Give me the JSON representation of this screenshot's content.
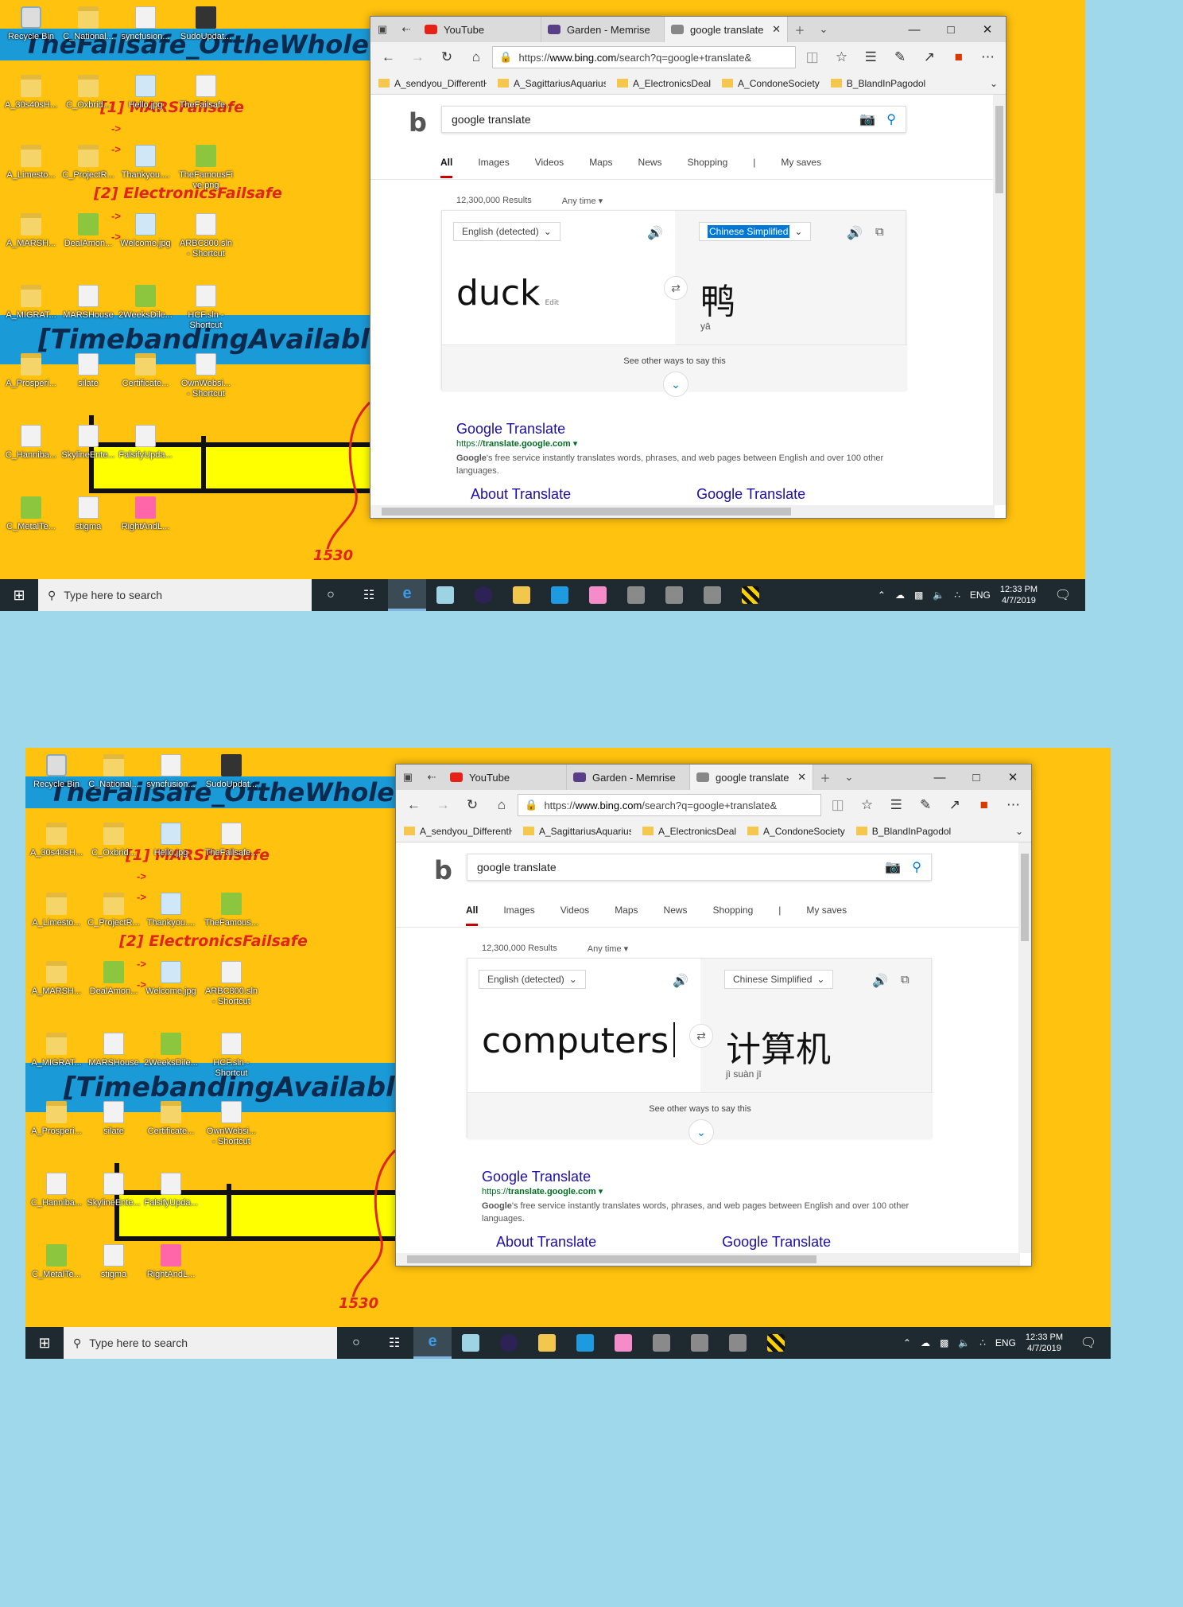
{
  "shots": [
    {
      "desktop": {
        "icons": [
          {
            "label": "Recycle Bin",
            "kind": "recycle"
          },
          {
            "label": "C_National...",
            "kind": "folder"
          },
          {
            "label": "syncfusion...",
            "kind": "file"
          },
          {
            "label": "SudoUpdat...",
            "kind": "dark"
          },
          {
            "label": "A_30s40sH...",
            "kind": "folder"
          },
          {
            "label": "C_Oxbrid...",
            "kind": "folder"
          },
          {
            "label": "Hello.jpg",
            "kind": "img"
          },
          {
            "label": "TheFailsafe...",
            "kind": "file"
          },
          {
            "label": "A_Limesto...",
            "kind": "folder"
          },
          {
            "label": "C_ProjectR...",
            "kind": "folder"
          },
          {
            "label": "Thankyou....",
            "kind": "img"
          },
          {
            "label": "TheFamousFi\nve.png",
            "kind": "green"
          },
          {
            "label": "A_MARSH...",
            "kind": "folder"
          },
          {
            "label": "DealAmon...",
            "kind": "green"
          },
          {
            "label": "Welcome.jpg",
            "kind": "img"
          },
          {
            "label": "ARBC800.sln\n- Shortcut",
            "kind": "file"
          },
          {
            "label": "A_MIGRAT...",
            "kind": "folder"
          },
          {
            "label": "MARSHouse",
            "kind": "file"
          },
          {
            "label": "2WeeksDile...",
            "kind": "green"
          },
          {
            "label": "HCF.sln -\nShortcut",
            "kind": "file"
          },
          {
            "label": "A_Prosperi...",
            "kind": "folder"
          },
          {
            "label": "silate",
            "kind": "file"
          },
          {
            "label": "Certificate...",
            "kind": "folder"
          },
          {
            "label": "OwnWebsi...\n- Shortcut",
            "kind": "file"
          },
          {
            "label": "C_Hanniba...",
            "kind": "file"
          },
          {
            "label": "SkylineEnte...",
            "kind": "file"
          },
          {
            "label": "FalsifyUpda...",
            "kind": "file"
          },
          {
            "label": "",
            "kind": "none"
          },
          {
            "label": "C_MetalTe...",
            "kind": "green"
          },
          {
            "label": "stigma",
            "kind": "file"
          },
          {
            "label": "RightAndL...",
            "kind": "pink"
          }
        ],
        "banner_top": "TheFailsafe_OftheWholeOp",
        "banner_mid": "[TimebandingAvailable]_f",
        "red_note_1": "[1] MARSFailsafe",
        "red_note_2": "[2] ElectronicsFailsafe",
        "arrow_1": "->",
        "arrow_2": "->",
        "arrow_3": "->",
        "arrow_4": "->",
        "year_label": "1530"
      },
      "browser": {
        "tabs": [
          {
            "label": "YouTube",
            "color": "#e62117",
            "active": false
          },
          {
            "label": "Garden - Memrise",
            "color": "#5a3e8a",
            "active": false
          },
          {
            "label": "google translate",
            "color": "#888888",
            "active": true
          }
        ],
        "url_prefix": "https://",
        "url_host": "www.bing.com",
        "url_rest": "/search?q=google+translate&",
        "bookmarks": [
          "A_sendyou_DifferentH",
          "A_SagittariusAquarius",
          "A_ElectronicsDeal",
          "A_CondoneSociety",
          "B_BlandInPagodol"
        ],
        "search_query": "google translate",
        "scopes": [
          "All",
          "Images",
          "Videos",
          "Maps",
          "News",
          "Shopping",
          "|",
          "My saves"
        ],
        "results_count": "12,300,000 Results",
        "time_filter": "Any time",
        "source_lang": "English (detected)",
        "target_lang": "Chinese Simplified",
        "target_highlighted": true,
        "source_text": "duck",
        "edit_label": "Edit",
        "target_text": "鸭",
        "target_pinyin": "yā",
        "other_ways": "See other ways to say this",
        "result_title": "Google Translate",
        "result_url_plain": "https://",
        "result_url_bold": "translate.google.com",
        "result_desc_bold": "Google",
        "result_desc": "'s free service instantly translates words, phrases, and web pages between English and over 100 other languages.",
        "sublink_1": "About Translate",
        "sublink_2": "Google Translate"
      },
      "taskbar": {
        "search_placeholder": "Type here to search",
        "lang": "ENG",
        "time": "12:33 PM",
        "date": "4/7/2019"
      }
    },
    {
      "desktop": {
        "icons": [
          {
            "label": "Recycle Bin",
            "kind": "recycle"
          },
          {
            "label": "C_National...",
            "kind": "folder"
          },
          {
            "label": "syncfusion...",
            "kind": "file"
          },
          {
            "label": "SudoUpdat...",
            "kind": "dark"
          },
          {
            "label": "A_30s40sH...",
            "kind": "folder"
          },
          {
            "label": "C_Oxbrid...",
            "kind": "folder"
          },
          {
            "label": "Hello.jpg",
            "kind": "img"
          },
          {
            "label": "TheFailsafe...",
            "kind": "file"
          },
          {
            "label": "A_Limesto...",
            "kind": "folder"
          },
          {
            "label": "C_ProjectR...",
            "kind": "folder"
          },
          {
            "label": "Thankyou....",
            "kind": "img"
          },
          {
            "label": "TheFamous...",
            "kind": "green"
          },
          {
            "label": "A_MARSH...",
            "kind": "folder"
          },
          {
            "label": "DealAmon...",
            "kind": "green"
          },
          {
            "label": "Welcome.jpg",
            "kind": "img"
          },
          {
            "label": "ARBC800.sln\n- Shortcut",
            "kind": "file"
          },
          {
            "label": "A_MIGRAT...",
            "kind": "folder"
          },
          {
            "label": "MARSHouse",
            "kind": "file"
          },
          {
            "label": "2WeeksDile...",
            "kind": "green"
          },
          {
            "label": "HCF.sln -\nShortcut",
            "kind": "file"
          },
          {
            "label": "A_Prosperi...",
            "kind": "folder"
          },
          {
            "label": "silate",
            "kind": "file"
          },
          {
            "label": "Certificate...",
            "kind": "folder"
          },
          {
            "label": "OwnWebsi...\n- Shortcut",
            "kind": "file"
          },
          {
            "label": "C_Hanniba...",
            "kind": "file"
          },
          {
            "label": "SkylineEnte...",
            "kind": "file"
          },
          {
            "label": "FalsifyUpda...",
            "kind": "file"
          },
          {
            "label": "",
            "kind": "none"
          },
          {
            "label": "C_MetalTe...",
            "kind": "green"
          },
          {
            "label": "stigma",
            "kind": "file"
          },
          {
            "label": "RightAndL...",
            "kind": "pink"
          }
        ],
        "banner_top": "TheFailsafe_OftheWholeOp",
        "banner_mid": "[TimebandingAvailable]_f",
        "red_note_1": "[1] MARSFailsafe",
        "red_note_2": "[2] ElectronicsFailsafe",
        "arrow_1": "->",
        "arrow_2": "->",
        "arrow_3": "->",
        "arrow_4": "->",
        "year_label": "1530"
      },
      "browser": {
        "tabs": [
          {
            "label": "YouTube",
            "color": "#e62117",
            "active": false
          },
          {
            "label": "Garden - Memrise",
            "color": "#5a3e8a",
            "active": false
          },
          {
            "label": "google translate",
            "color": "#888888",
            "active": true
          }
        ],
        "url_prefix": "https://",
        "url_host": "www.bing.com",
        "url_rest": "/search?q=google+translate&",
        "bookmarks": [
          "A_sendyou_DifferentH",
          "A_SagittariusAquarius",
          "A_ElectronicsDeal",
          "A_CondoneSociety",
          "B_BlandInPagodol"
        ],
        "search_query": "google translate",
        "scopes": [
          "All",
          "Images",
          "Videos",
          "Maps",
          "News",
          "Shopping",
          "|",
          "My saves"
        ],
        "results_count": "12,300,000 Results",
        "time_filter": "Any time",
        "source_lang": "English (detected)",
        "target_lang": "Chinese Simplified",
        "target_highlighted": false,
        "source_text": "computers",
        "edit_label": "",
        "target_text": "计算机",
        "target_pinyin": "jì suàn jī",
        "other_ways": "See other ways to say this",
        "result_title": "Google Translate",
        "result_url_plain": "https://",
        "result_url_bold": "translate.google.com",
        "result_desc_bold": "Google",
        "result_desc": "'s free service instantly translates words, phrases, and web pages between English and over 100 other languages.",
        "sublink_1": "About Translate",
        "sublink_2": "Google Translate"
      },
      "taskbar": {
        "search_placeholder": "Type here to search",
        "lang": "ENG",
        "time": "12:33 PM",
        "date": "4/7/2019"
      }
    }
  ]
}
